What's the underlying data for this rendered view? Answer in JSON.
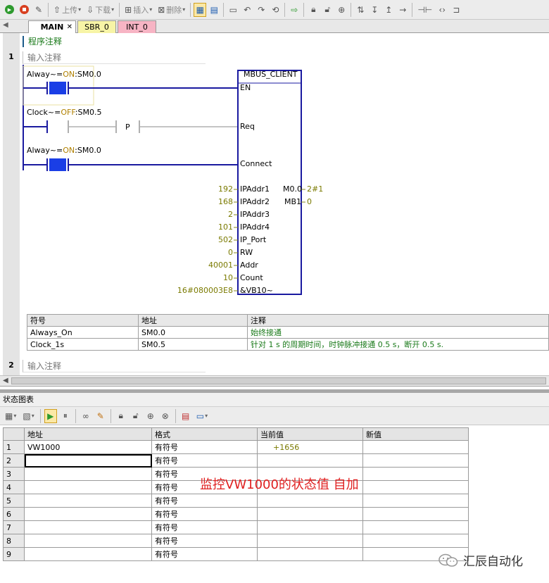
{
  "toolbar": {
    "upload_label": "上传",
    "download_label": "下载",
    "insert_label": "插入",
    "delete_label": "删除"
  },
  "tabs": [
    {
      "label": "MAIN"
    },
    {
      "label": "SBR_0"
    },
    {
      "label": "INT_0"
    }
  ],
  "program_comment": "程序注释",
  "networks": [
    {
      "number": "1",
      "comment": "输入注释"
    },
    {
      "number": "2",
      "comment": "输入注释"
    }
  ],
  "ladder": {
    "contact1": {
      "sym": "Alway~",
      "eq": "=",
      "state": "ON",
      "addr": ":SM0.0"
    },
    "contact2": {
      "sym": "Clock~",
      "eq": "=",
      "state": "OFF",
      "addr": ":SM0.5"
    },
    "contact3": {
      "sym": "Alway~",
      "eq": "=",
      "state": "ON",
      "addr": ":SM0.0"
    },
    "p_label": "P",
    "block_title": "MBUS_CLIENT",
    "inputs": [
      {
        "pin": "EN",
        "value": ""
      },
      {
        "pin": "Req",
        "value": ""
      },
      {
        "pin": "Connect",
        "value": ""
      },
      {
        "pin": "IPAddr1",
        "value": "192"
      },
      {
        "pin": "IPAddr2",
        "value": "168"
      },
      {
        "pin": "IPAddr3",
        "value": "2"
      },
      {
        "pin": "IPAddr4",
        "value": "101"
      },
      {
        "pin": "IP_Port",
        "value": "502"
      },
      {
        "pin": "RW",
        "value": "0"
      },
      {
        "pin": "Addr",
        "value": "40001"
      },
      {
        "pin": "Count",
        "value": "10"
      },
      {
        "pin": "&VB10~",
        "value": "16#080003E8"
      }
    ],
    "outputs": [
      {
        "pin": "M0.0",
        "value": "2#1"
      },
      {
        "pin": "MB1",
        "value": "0"
      }
    ]
  },
  "symbol_table": {
    "headers": [
      "符号",
      "地址",
      "注释"
    ],
    "rows": [
      [
        "Always_On",
        "SM0.0",
        "始终接通"
      ],
      [
        "Clock_1s",
        "SM0.5",
        "针对 1 s 的周期时间，时钟脉冲接通 0.5 s，断开 0.5 s."
      ]
    ]
  },
  "status_chart": {
    "title": "状态图表",
    "headers": [
      "",
      "地址",
      "格式",
      "当前值",
      "新值"
    ],
    "rows": [
      {
        "n": "1",
        "addr": "VW1000",
        "fmt": "有符号",
        "cur": "+1656",
        "new": ""
      },
      {
        "n": "2",
        "addr": "",
        "fmt": "有符号",
        "cur": "",
        "new": ""
      },
      {
        "n": "3",
        "addr": "",
        "fmt": "有符号",
        "cur": "",
        "new": ""
      },
      {
        "n": "4",
        "addr": "",
        "fmt": "有符号",
        "cur": "",
        "new": ""
      },
      {
        "n": "5",
        "addr": "",
        "fmt": "有符号",
        "cur": "",
        "new": ""
      },
      {
        "n": "6",
        "addr": "",
        "fmt": "有符号",
        "cur": "",
        "new": ""
      },
      {
        "n": "7",
        "addr": "",
        "fmt": "有符号",
        "cur": "",
        "new": ""
      },
      {
        "n": "8",
        "addr": "",
        "fmt": "有符号",
        "cur": "",
        "new": ""
      },
      {
        "n": "9",
        "addr": "",
        "fmt": "有符号",
        "cur": "",
        "new": ""
      }
    ]
  },
  "annotation": "监控VW1000的状态值 自加",
  "watermark": "汇辰自动化",
  "colors": {
    "ladder_blue": "#1a1aa0",
    "contact_fill": "#1a3ee6",
    "comment_green": "#1a7a1a",
    "annotation_red": "#e02020"
  }
}
